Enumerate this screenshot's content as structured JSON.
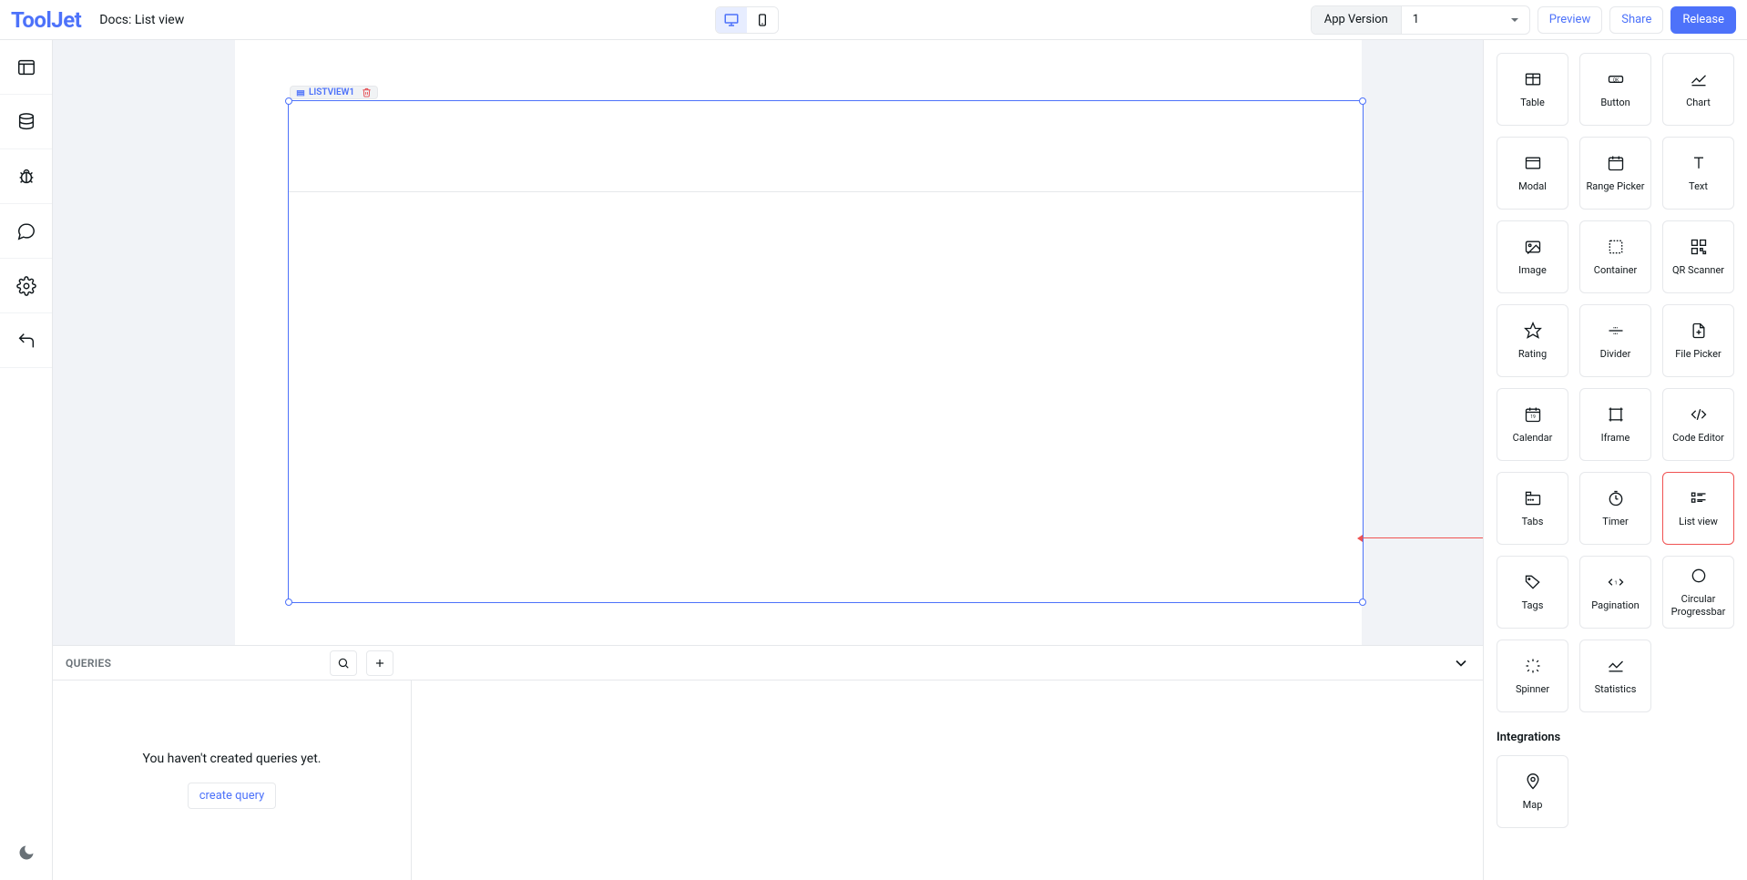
{
  "header": {
    "logo": "ToolJet",
    "breadcrumb": "Docs: List view",
    "version_label": "App Version",
    "version_value": "1",
    "preview": "Preview",
    "share": "Share",
    "release": "Release"
  },
  "canvas": {
    "selected_widget": "LISTVIEW1"
  },
  "queries": {
    "title": "QUERIES",
    "empty": "You haven't created queries yet.",
    "create": "create query"
  },
  "widgets": {
    "items": [
      {
        "label": "Table",
        "icon": "table"
      },
      {
        "label": "Button",
        "icon": "button"
      },
      {
        "label": "Chart",
        "icon": "chart"
      },
      {
        "label": "Modal",
        "icon": "modal"
      },
      {
        "label": "Range Picker",
        "icon": "range"
      },
      {
        "label": "Text",
        "icon": "text"
      },
      {
        "label": "Image",
        "icon": "image"
      },
      {
        "label": "Container",
        "icon": "container"
      },
      {
        "label": "QR Scanner",
        "icon": "qr"
      },
      {
        "label": "Rating",
        "icon": "star"
      },
      {
        "label": "Divider",
        "icon": "divider"
      },
      {
        "label": "File Picker",
        "icon": "file"
      },
      {
        "label": "Calendar",
        "icon": "calendar"
      },
      {
        "label": "Iframe",
        "icon": "iframe"
      },
      {
        "label": "Code Editor",
        "icon": "code"
      },
      {
        "label": "Tabs",
        "icon": "tabs"
      },
      {
        "label": "Timer",
        "icon": "timer"
      },
      {
        "label": "List view",
        "icon": "listview",
        "highlight": true
      },
      {
        "label": "Tags",
        "icon": "tags"
      },
      {
        "label": "Pagination",
        "icon": "pagination"
      },
      {
        "label": "Circular Progressbar",
        "icon": "circular"
      },
      {
        "label": "Spinner",
        "icon": "spinner"
      },
      {
        "label": "Statistics",
        "icon": "stats"
      }
    ],
    "integrations_heading": "Integrations",
    "integrations": [
      {
        "label": "Map",
        "icon": "map"
      }
    ]
  }
}
